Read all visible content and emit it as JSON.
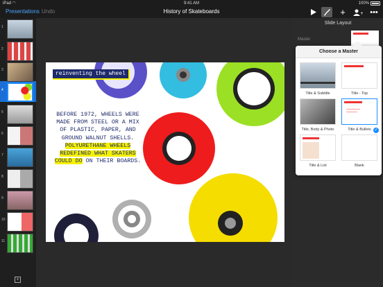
{
  "status": {
    "time": "9:41 AM",
    "battery": "100%"
  },
  "toolbar": {
    "presentations_label": "Presentations",
    "undo_label": "Undo",
    "title": "History of Skateboards"
  },
  "sidebar": {
    "slide_numbers": [
      "1",
      "2",
      "3",
      "4",
      "5",
      "6",
      "7",
      "8",
      "9",
      "10",
      "11"
    ],
    "selected": 4
  },
  "slide": {
    "banner": "reinventing the wheel",
    "text_plain": "BEFORE 1972, WHEELS WERE MADE FROM STEEL OR A MIX OF PLASTIC, PAPER, AND GROUND WALNUT SHELLS.",
    "text_highlight": "POLYURETHANE WHEELS REDEFINED WHAT SKATERS COULD DO",
    "text_tail": "ON THEIR BOARDS."
  },
  "panel": {
    "header": "Slide Layout",
    "master_label": "Master"
  },
  "popover": {
    "title": "Choose a Master",
    "layouts": [
      {
        "label": "Title & Subtitle"
      },
      {
        "label": "Title - Top"
      },
      {
        "label": "Title, Body & Photo"
      },
      {
        "label": "Title & Bullets"
      },
      {
        "label": "Title & List"
      },
      {
        "label": "Blank"
      }
    ],
    "selected_index": 3
  },
  "colors": {
    "accent": "#1b8dff",
    "navy": "#1d2b6a",
    "yellow": "#f5f000"
  }
}
